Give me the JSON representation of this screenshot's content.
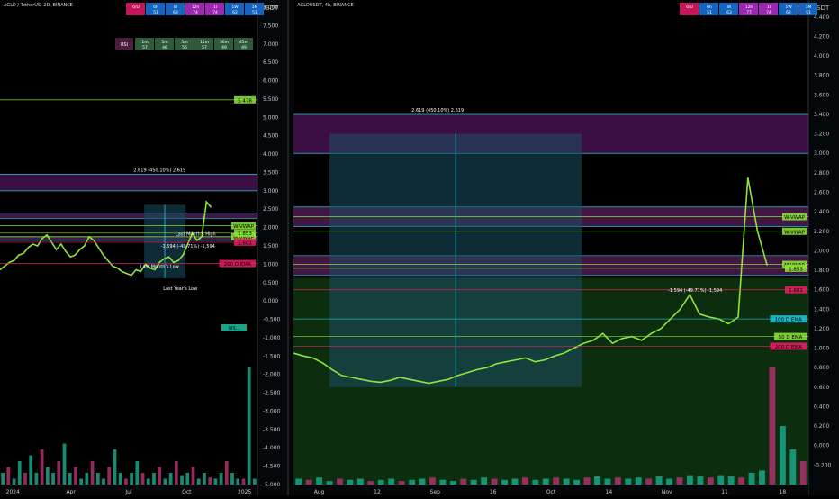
{
  "colors": {
    "background": "#000000",
    "price_line": "#8ee63a",
    "mid_band": "#7a2a7a",
    "purple_zone": "#6a1b7a",
    "green_zone": "#0f3a12",
    "blue_zone": "#1c4f63",
    "cyan_line": "#26c6da",
    "volume_up": "#1aa58a",
    "volume_down": "#b0306e",
    "axis_bg": "#05080a",
    "axis_text": "#c8c8c8"
  },
  "chart_data": [
    {
      "type": "line",
      "title": "AGLD / TetherUS, 2D, BINANCE",
      "yunit": "USDT",
      "x_tick_labels": [
        "2024",
        "Apr",
        "Jul",
        "Oct",
        "2025"
      ],
      "y_ticks": [
        "8.000",
        "7.500",
        "7.000",
        "6.500",
        "6.000",
        "5.500",
        "5.000",
        "4.500",
        "4.000",
        "3.500",
        "3.000",
        "2.500",
        "2.000",
        "1.500",
        "1.000",
        "0.500",
        "0.000",
        "-0.500",
        "-1.000",
        "-1.500",
        "-2.000",
        "-2.500",
        "-3.000",
        "-3.500",
        "-4.000",
        "-4.500",
        "-5.000"
      ],
      "ylim": [
        -5.0,
        8.0
      ],
      "price_series": [
        0.85,
        0.95,
        1.05,
        1.1,
        1.25,
        1.3,
        1.45,
        1.55,
        1.5,
        1.7,
        1.8,
        1.6,
        1.4,
        1.55,
        1.35,
        1.2,
        1.25,
        1.4,
        1.5,
        1.75,
        1.65,
        1.45,
        1.25,
        1.1,
        0.95,
        0.9,
        0.8,
        0.75,
        0.7,
        0.85,
        0.8,
        1.0,
        0.9,
        0.85,
        1.05,
        1.15,
        1.2,
        1.05,
        1.1,
        1.25,
        1.55,
        1.85,
        1.65,
        1.75,
        2.7,
        2.55
      ],
      "zones": [
        {
          "label": "2.619 (450.10%) 2,619",
          "y_from": 3.45,
          "y_to": 3.0
        },
        {
          "label": "",
          "y_from": 2.4,
          "y_to": 2.25
        },
        {
          "label": "",
          "y_from": 1.75,
          "y_to": 1.65
        }
      ],
      "levels": [
        {
          "label": "5.478",
          "value": 5.478,
          "color": "#8ee63a"
        },
        {
          "label": "W-VWAP",
          "value": 2.05,
          "color": "#8ee63a"
        },
        {
          "label": "M-VWAP",
          "value": 1.75,
          "color": "#8ee63a"
        },
        {
          "label": "1.853",
          "value": 1.85,
          "color": "#8ee63a"
        },
        {
          "label": "1.601",
          "value": 1.6,
          "color": "#e91e63"
        },
        {
          "label": "200 D EMA",
          "value": 1.02,
          "color": "#e91e63"
        }
      ],
      "annotations": [
        {
          "text": "-1.594 (-49.71%) -1,594",
          "x": 0.73,
          "y": 1.45
        },
        {
          "text": "Last Month's High",
          "x": 0.76,
          "y": 1.78
        },
        {
          "text": "Last Month's Low",
          "x": 0.62,
          "y": 0.9
        },
        {
          "text": "Last Year's Low",
          "x": 0.7,
          "y": 0.3
        }
      ],
      "volume": [
        0.1,
        0.15,
        0.05,
        0.2,
        0.1,
        0.25,
        0.1,
        0.3,
        0.15,
        0.1,
        0.2,
        0.35,
        0.1,
        0.15,
        0.05,
        0.1,
        0.2,
        0.1,
        0.05,
        0.15,
        0.3,
        0.1,
        0.05,
        0.1,
        0.2,
        0.1,
        0.05,
        0.1,
        0.15,
        0.05,
        0.1,
        0.2,
        0.08,
        0.1,
        0.15,
        0.05,
        0.1,
        0.06,
        0.05,
        0.1,
        0.2,
        0.1,
        0.05,
        0.05,
        1.0,
        0.05
      ],
      "volume_label": "WS..."
    },
    {
      "type": "line",
      "title": "AGLDUSDT, 4h, BINANCE",
      "yunit": "USDT",
      "x_tick_labels": [
        "Aug",
        "12",
        "Sep",
        "16",
        "Oct",
        "14",
        "Nov",
        "11",
        "18"
      ],
      "y_ticks": [
        "4.400",
        "4.200",
        "4.000",
        "3.800",
        "3.600",
        "3.400",
        "3.200",
        "3.000",
        "2.800",
        "2.600",
        "2.400",
        "2.200",
        "2.000",
        "1.800",
        "1.600",
        "1.400",
        "1.200",
        "1.000",
        "0.800",
        "0.600",
        "0.400",
        "0.200",
        "0.000",
        "-0.200"
      ],
      "ylim": [
        -0.4,
        4.5
      ],
      "price_series": [
        0.95,
        0.92,
        0.9,
        0.85,
        0.78,
        0.72,
        0.7,
        0.68,
        0.66,
        0.65,
        0.67,
        0.7,
        0.68,
        0.66,
        0.64,
        0.66,
        0.68,
        0.72,
        0.75,
        0.78,
        0.8,
        0.84,
        0.86,
        0.88,
        0.9,
        0.86,
        0.88,
        0.92,
        0.95,
        1.0,
        1.05,
        1.08,
        1.15,
        1.05,
        1.1,
        1.12,
        1.08,
        1.15,
        1.2,
        1.3,
        1.4,
        1.55,
        1.35,
        1.32,
        1.3,
        1.25,
        1.32,
        2.75,
        2.2,
        1.85
      ],
      "zones": [
        {
          "label": "2.619 (450.10%) 2,619",
          "y_from": 3.4,
          "y_to": 3.0
        },
        {
          "label": "",
          "y_from": 2.45,
          "y_to": 2.25
        },
        {
          "label": "",
          "y_from": 1.95,
          "y_to": 1.75
        }
      ],
      "levels": [
        {
          "label": "W-VWAP",
          "value": 2.35,
          "color": "#8ee63a"
        },
        {
          "label": "W-VWAP",
          "value": 2.2,
          "color": "#8ee63a"
        },
        {
          "label": "M-VWAP",
          "value": 1.86,
          "color": "#8ee63a"
        },
        {
          "label": "1.853",
          "value": 1.82,
          "color": "#8ee63a"
        },
        {
          "label": "1.601",
          "value": 1.6,
          "color": "#e91e63"
        },
        {
          "label": "100 D EMA",
          "value": 1.3,
          "color": "#26c6da"
        },
        {
          "label": "50 D EMA",
          "value": 1.12,
          "color": "#8ee63a"
        },
        {
          "label": "200 D EMA",
          "value": 1.02,
          "color": "#e91e63"
        }
      ],
      "annotations": [
        {
          "text": "-1.594 (-49.71%) -1,594",
          "x": 0.78,
          "y": 1.58
        }
      ],
      "volume": [
        0.05,
        0.04,
        0.06,
        0.03,
        0.05,
        0.04,
        0.05,
        0.03,
        0.04,
        0.05,
        0.03,
        0.04,
        0.05,
        0.06,
        0.04,
        0.03,
        0.05,
        0.04,
        0.06,
        0.05,
        0.04,
        0.05,
        0.06,
        0.04,
        0.05,
        0.06,
        0.05,
        0.04,
        0.06,
        0.07,
        0.05,
        0.06,
        0.05,
        0.06,
        0.05,
        0.07,
        0.05,
        0.06,
        0.08,
        0.07,
        0.06,
        0.08,
        0.07,
        0.06,
        0.1,
        0.12,
        1.0,
        0.5,
        0.3,
        0.2
      ]
    }
  ],
  "left_panel": {
    "timeframe_table": {
      "headers": [
        "6/U",
        "6h",
        "8l",
        "12h",
        "1l",
        "1W",
        "1M"
      ],
      "values": [
        "",
        "51",
        "63",
        "74",
        "74",
        "62",
        "51"
      ]
    },
    "rsi_table": {
      "label": "RSI",
      "headers": [
        "1m",
        "5m",
        "5m",
        "15m",
        "30m",
        "45m"
      ],
      "values": [
        "57",
        "46",
        "56",
        "57",
        "49",
        "49"
      ]
    }
  },
  "right_panel": {
    "timeframe_table": {
      "headers": [
        "6/U",
        "6h",
        "8l",
        "12h",
        "1l",
        "1W",
        "1M"
      ],
      "values": [
        "",
        "51",
        "63",
        "77",
        "74",
        "62",
        "51"
      ]
    }
  }
}
